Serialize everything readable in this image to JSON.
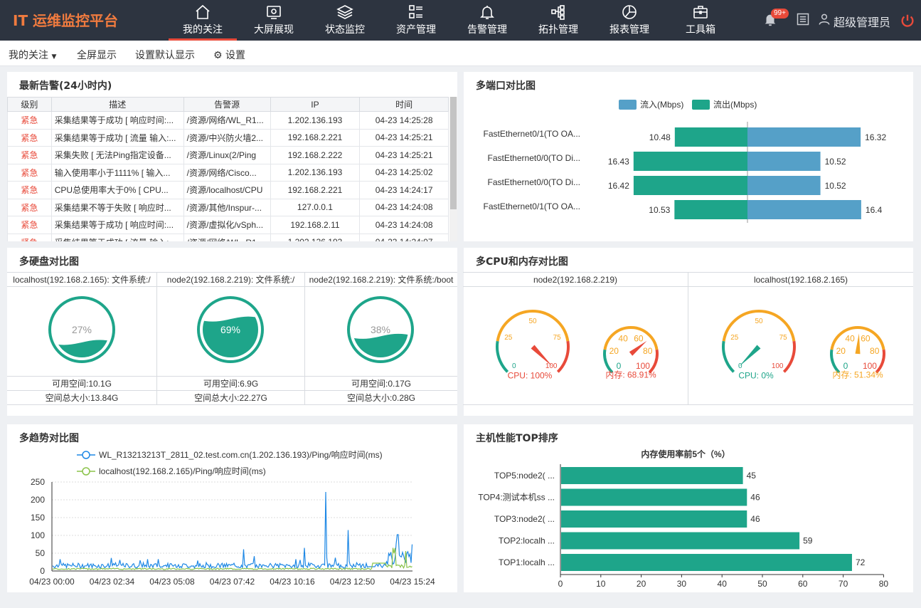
{
  "app": {
    "title": "IT 运维监控平台",
    "badge": "99+",
    "user": "超级管理员"
  },
  "nav": [
    {
      "label": "我的关注",
      "icon": "home-icon"
    },
    {
      "label": "大屏展现",
      "icon": "screen-icon"
    },
    {
      "label": "状态监控",
      "icon": "layers-icon"
    },
    {
      "label": "资产管理",
      "icon": "list-icon"
    },
    {
      "label": "告警管理",
      "icon": "bell-icon"
    },
    {
      "label": "拓扑管理",
      "icon": "topology-icon"
    },
    {
      "label": "报表管理",
      "icon": "pie-chart-icon"
    },
    {
      "label": "工具箱",
      "icon": "toolbox-icon"
    }
  ],
  "subbar": {
    "focus": "我的关注",
    "fullscreen": "全屏显示",
    "set_default": "设置默认显示",
    "settings": "设置"
  },
  "alarms": {
    "title": "最新告警(24小时内)",
    "headers": [
      "级别",
      "描述",
      "告警源",
      "IP",
      "时间"
    ],
    "rows": [
      [
        "紧急",
        "采集结果等于成功 [ 响应时间:...",
        "/资源/网络/WL_R1...",
        "1.202.136.193",
        "04-23 14:25:28"
      ],
      [
        "紧急",
        "采集结果等于成功 [ 流量 输入:...",
        "/资源/中兴防火墙2...",
        "192.168.2.221",
        "04-23 14:25:21"
      ],
      [
        "紧急",
        "采集失败 [ 无法Ping指定设备...",
        "/资源/Linux(2/Ping",
        "192.168.2.222",
        "04-23 14:25:21"
      ],
      [
        "紧急",
        "输入使用率小于1111% [ 输入...",
        "/资源/网络/Cisco...",
        "1.202.136.193",
        "04-23 14:25:02"
      ],
      [
        "紧急",
        "CPU总使用率大于0% [ CPU...",
        "/资源/localhost/CPU",
        "192.168.2.221",
        "04-23 14:24:17"
      ],
      [
        "紧急",
        "采集结果不等于失败 [ 响应时...",
        "/资源/其他/Inspur-...",
        "127.0.0.1",
        "04-23 14:24:08"
      ],
      [
        "紧急",
        "采集结果等于成功 [ 响应时间:...",
        "/资源/虚拟化/vSph...",
        "192.168.2.11",
        "04-23 14:24:08"
      ],
      [
        "紧急",
        "采集结果等于成功 [ 流量 输入:...",
        "/资源/网络/WL_R1...",
        "1.202.136.193",
        "04-23 14:24:07"
      ]
    ]
  },
  "ports": {
    "title": "多端口对比图",
    "legend_in": "流入(Mbps)",
    "legend_out": "流出(Mbps)",
    "colors": {
      "in": "#55a0c8",
      "out": "#1ea58a"
    },
    "items": [
      {
        "name": "FastEthernet0/1(TO OA...",
        "out": 10.48,
        "in": 16.32
      },
      {
        "name": "FastEthernet0/0(TO Di...",
        "out": 16.43,
        "in": 10.52
      },
      {
        "name": "FastEthernet0/0(TO Di...",
        "out": 16.42,
        "in": 10.52
      },
      {
        "name": "FastEthernet0/1(TO OA...",
        "out": 10.53,
        "in": 16.4
      }
    ]
  },
  "disks": {
    "title": "多硬盘对比图",
    "items": [
      {
        "name": "localhost(192.168.2.165): 文件系统:/",
        "pct": 27,
        "pct_label": "27%",
        "free": "可用空间:10.1G",
        "total": "空间总大小:13.84G"
      },
      {
        "name": "node2(192.168.2.219): 文件系统:/",
        "pct": 69,
        "pct_label": "69%",
        "free": "可用空间:6.9G",
        "total": "空间总大小:22.27G"
      },
      {
        "name": "node2(192.168.2.219): 文件系统:/boot",
        "pct": 38,
        "pct_label": "38%",
        "free": "可用空间:0.17G",
        "total": "空间总大小:0.28G"
      }
    ]
  },
  "cpu": {
    "title": "多CPU和内存对比图",
    "hosts": [
      {
        "name": "node2(192.168.2.219)",
        "cpu": 100,
        "cpu_label": "CPU: 100%",
        "mem": 68.91,
        "mem_label": "内存: 68.91%"
      },
      {
        "name": "localhost(192.168.2.165)",
        "cpu": 0,
        "cpu_label": "CPU: 0%",
        "mem": 51.34,
        "mem_label": "内存: 51.34%"
      }
    ],
    "cpu_ticks": [
      "0",
      "25",
      "50",
      "75",
      "100"
    ],
    "mem_ticks": [
      "0",
      "20",
      "40",
      "60",
      "80",
      "100"
    ]
  },
  "trend": {
    "title": "多趋势对比图",
    "series_names": [
      "WL_R13213213T_2811_02.test.com.cn(1.202.136.193)/Ping/响应时间(ms)",
      "localhost(192.168.2.165)/Ping/响应时间(ms)"
    ],
    "colors": [
      "#1e88e5",
      "#8bc34a"
    ],
    "yticks": [
      "250",
      "200",
      "150",
      "100",
      "50",
      "0"
    ],
    "xticks": [
      "04/23 00:00",
      "04/23 02:34",
      "04/23 05:08",
      "04/23 07:42",
      "04/23 10:16",
      "04/23 12:50",
      "04/23 15:24"
    ]
  },
  "top": {
    "title": "主机性能TOP排序",
    "chart_title": "内存使用率前5个（%）",
    "items": [
      {
        "label": "TOP5:node2( ...",
        "value": 45
      },
      {
        "label": "TOP4:测试本机ss ...",
        "value": 46
      },
      {
        "label": "TOP3:node2( ...",
        "value": 46
      },
      {
        "label": "TOP2:localh ...",
        "value": 59
      },
      {
        "label": "TOP1:localh ...",
        "value": 72
      }
    ],
    "xticks": [
      "0",
      "10",
      "20",
      "30",
      "40",
      "50",
      "60",
      "70",
      "80"
    ],
    "color": "#1ea58a"
  },
  "chart_data": [
    {
      "type": "bar",
      "title": "多端口对比图",
      "categories": [
        "FastEthernet0/1(TO OA...",
        "FastEthernet0/0(TO Di...",
        "FastEthernet0/0(TO Di...",
        "FastEthernet0/1(TO OA..."
      ],
      "series": [
        {
          "name": "流入(Mbps)",
          "values": [
            16.32,
            10.52,
            10.52,
            16.4
          ]
        },
        {
          "name": "流出(Mbps)",
          "values": [
            10.48,
            16.43,
            16.42,
            10.53
          ]
        }
      ],
      "legend": "top"
    },
    {
      "type": "line",
      "title": "多趋势对比图",
      "ylim": [
        0,
        250
      ],
      "series": [
        {
          "name": "WL_R13213213T_2811_02.test.com.cn(1.202.136.193)/Ping/响应时间(ms)",
          "values": []
        },
        {
          "name": "localhost(192.168.2.165)/Ping/响应时间(ms)",
          "values": []
        }
      ],
      "x": [
        "04/23 00:00",
        "04/23 02:34",
        "04/23 05:08",
        "04/23 07:42",
        "04/23 10:16",
        "04/23 12:50",
        "04/23 15:24"
      ]
    },
    {
      "type": "bar",
      "title": "内存使用率前5个（%）",
      "categories": [
        "TOP5:node2( ...",
        "TOP4:测试本机ss ...",
        "TOP3:node2( ...",
        "TOP2:localh ...",
        "TOP1:localh ..."
      ],
      "values": [
        45,
        46,
        46,
        59,
        72
      ],
      "xlim": [
        0,
        80
      ]
    }
  ]
}
